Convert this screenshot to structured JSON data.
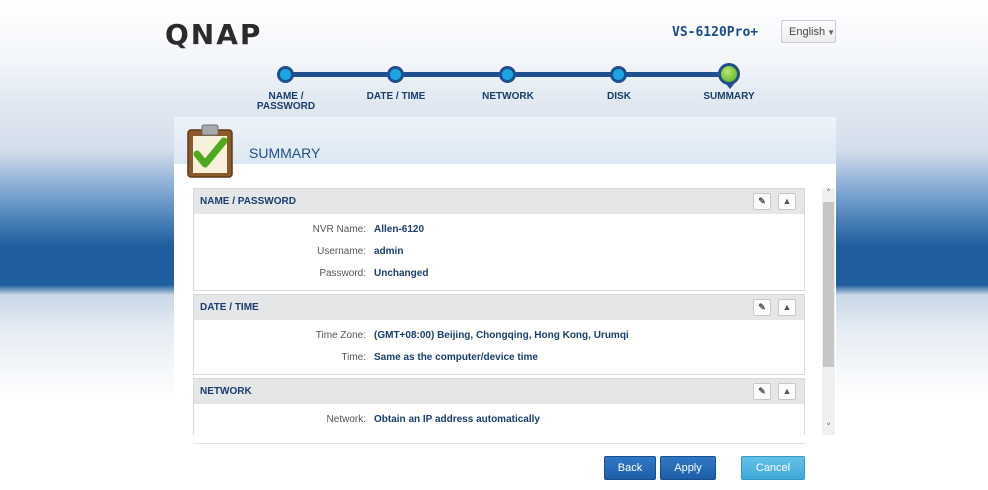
{
  "brand": {
    "logo": "QNAP",
    "model": "VS-6120Pro+"
  },
  "language": {
    "selected": "English"
  },
  "steps": [
    {
      "label": "NAME /\nPASSWORD"
    },
    {
      "label": "DATE / TIME"
    },
    {
      "label": "NETWORK"
    },
    {
      "label": "DISK"
    },
    {
      "label": "SUMMARY",
      "active": true
    }
  ],
  "panel": {
    "title": "SUMMARY"
  },
  "sections": {
    "name_password": {
      "title": "NAME / PASSWORD",
      "rows": [
        {
          "label": "NVR Name:",
          "value": "Allen-6120"
        },
        {
          "label": "Username:",
          "value": "admin"
        },
        {
          "label": "Password:",
          "value": "Unchanged"
        }
      ]
    },
    "date_time": {
      "title": "DATE / TIME",
      "rows": [
        {
          "label": "Time Zone:",
          "value": "(GMT+08:00) Beijing, Chongqing, Hong Kong, Urumqi"
        },
        {
          "label": "Time:",
          "value": "Same as the computer/device time"
        }
      ]
    },
    "network": {
      "title": "NETWORK",
      "rows": [
        {
          "label": "Network:",
          "value": "Obtain an IP address automatically"
        }
      ]
    }
  },
  "buttons": {
    "back": "Back",
    "apply": "Apply",
    "cancel": "Cancel"
  },
  "colors": {
    "accent": "#1f4f8c",
    "step_dot": "#1aa6e3",
    "active_step": "#4fab19",
    "cancel": "#3ea9d8"
  }
}
